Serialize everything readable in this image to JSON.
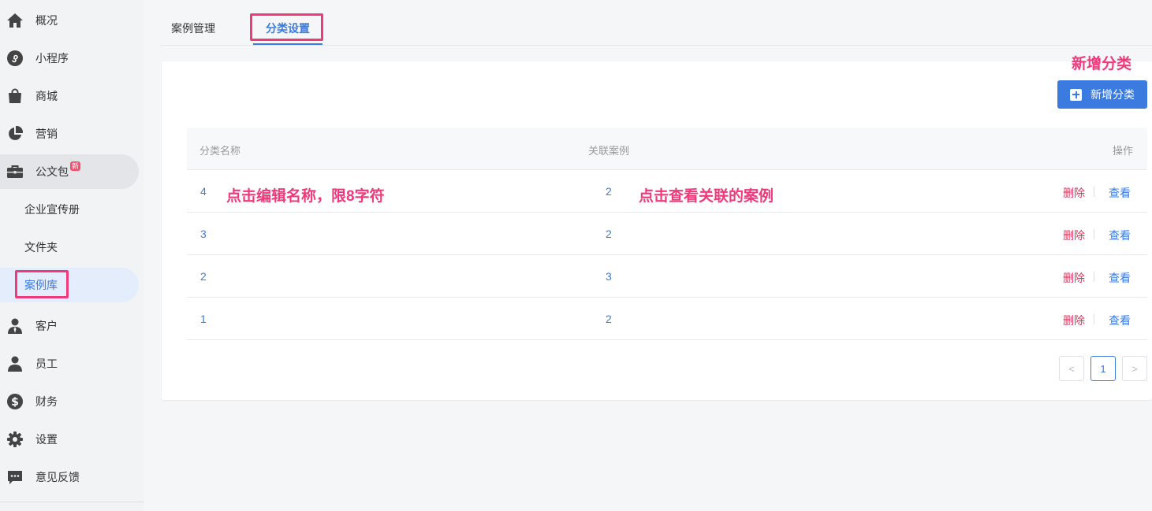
{
  "sidebar": {
    "items": [
      {
        "label": "概况",
        "icon": "home-icon"
      },
      {
        "label": "小程序",
        "icon": "miniprogram-icon"
      },
      {
        "label": "商城",
        "icon": "shopping-bag-icon"
      },
      {
        "label": "营销",
        "icon": "pie-chart-icon"
      },
      {
        "label": "公文包",
        "icon": "briefcase-icon",
        "badge": "新"
      },
      {
        "label": "客户",
        "icon": "customer-icon"
      },
      {
        "label": "员工",
        "icon": "user-icon"
      },
      {
        "label": "财务",
        "icon": "dollar-icon"
      },
      {
        "label": "设置",
        "icon": "gear-icon"
      },
      {
        "label": "意见反馈",
        "icon": "feedback-icon"
      }
    ],
    "sub_items": [
      {
        "label": "企业宣传册"
      },
      {
        "label": "文件夹"
      },
      {
        "label": "案例库"
      }
    ]
  },
  "tabs": [
    {
      "label": "案例管理"
    },
    {
      "label": "分类设置"
    }
  ],
  "annotations": {
    "add": "新增分类",
    "edit_name": "点击编辑名称，限8字符",
    "view_cases": "点击查看关联的案例"
  },
  "toolbar": {
    "add_label": "新增分类"
  },
  "table": {
    "headers": [
      "分类名称",
      "关联案例",
      "操作"
    ],
    "rows": [
      {
        "name": "4",
        "cases": "2"
      },
      {
        "name": "3",
        "cases": "2"
      },
      {
        "name": "2",
        "cases": "3"
      },
      {
        "name": "1",
        "cases": "2"
      }
    ],
    "delete_label": "删除",
    "view_label": "查看"
  },
  "pagination": {
    "prev": "<",
    "current": "1",
    "next": ">"
  },
  "colors": {
    "accent": "#3b7be0",
    "highlight": "#f0397a",
    "danger": "#e0305b"
  }
}
